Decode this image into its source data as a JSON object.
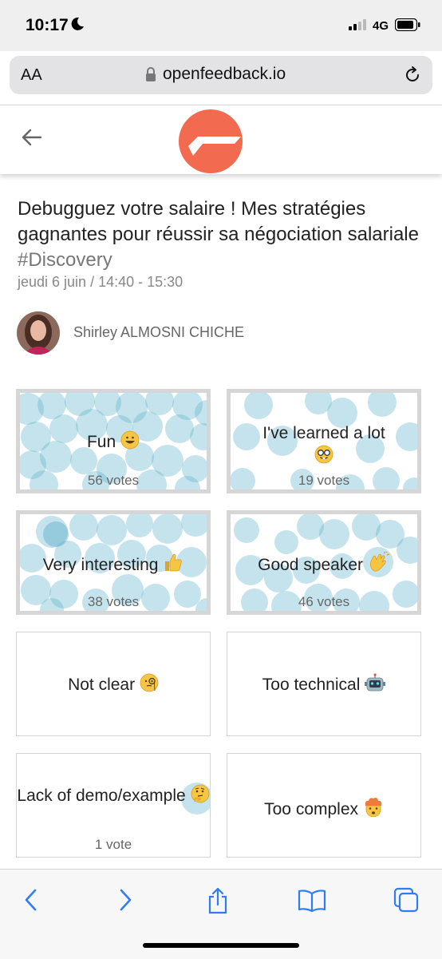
{
  "status": {
    "time": "10:17",
    "network": "4G"
  },
  "browser": {
    "aa_label": "AA",
    "domain": "openfeedback.io"
  },
  "session": {
    "title": "Debugguez votre salaire ! Mes stratégies gagnantes pour réussir sa négociation salariale",
    "tag": "#Discovery",
    "date": "jeudi 6 juin / 14:40 - 15:30",
    "speaker": "Shirley ALMOSNI CHICHE"
  },
  "feedback": [
    {
      "label": "Fun",
      "emoji": "grinning-face",
      "votes_text": "56 votes",
      "votes": 56
    },
    {
      "label": "I've learned a lot",
      "emoji": "nerd-face",
      "votes_text": "19 votes",
      "votes": 19
    },
    {
      "label": "Very interesting",
      "emoji": "thumbs-up",
      "votes_text": "38 votes",
      "votes": 38
    },
    {
      "label": "Good speaker",
      "emoji": "clapping-hands",
      "votes_text": "46 votes",
      "votes": 46
    },
    {
      "label": "Not clear",
      "emoji": "face-with-monocle",
      "votes_text": "",
      "votes": 0
    },
    {
      "label": "Too technical",
      "emoji": "robot",
      "votes_text": "",
      "votes": 0
    },
    {
      "label": "Lack of demo/example",
      "emoji": "thinking-face",
      "votes_text": "1 vote",
      "votes": 1
    },
    {
      "label": "Too complex",
      "emoji": "exploding-head",
      "votes_text": "",
      "votes": 0
    }
  ],
  "colors": {
    "accent": "#f26a4f",
    "bubble": "#5aaec9",
    "border": "#d4d4d4",
    "ios_blue": "#2f7cf6"
  }
}
